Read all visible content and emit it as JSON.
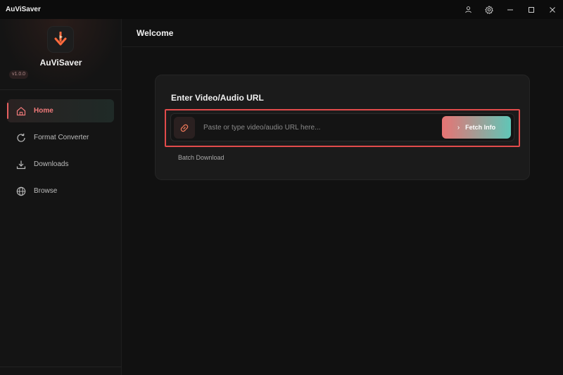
{
  "window": {
    "title": "AuViSaver"
  },
  "titlebar_icons": [
    "user-icon",
    "gear-icon",
    "minimize-icon",
    "maximize-icon",
    "close-icon"
  ],
  "sidebar": {
    "app_name": "AuViSaver",
    "version": "v1.0.0",
    "items": [
      {
        "label": "Home",
        "icon": "home-icon",
        "active": true
      },
      {
        "label": "Format Converter",
        "icon": "refresh-icon",
        "active": false
      },
      {
        "label": "Downloads",
        "icon": "download-icon",
        "active": false
      },
      {
        "label": "Browse",
        "icon": "globe-icon",
        "active": false
      }
    ]
  },
  "header": {
    "title": "Welcome"
  },
  "card": {
    "title": "Enter Video/Audio URL",
    "url_input": {
      "value": "",
      "placeholder": "Paste or type video/audio URL here..."
    },
    "fetch_button": "Fetch Info",
    "batch_link": "Batch Download"
  },
  "colors": {
    "accent": "#e86060",
    "highlight_border": "#e24b4b",
    "gradient_start": "#e87373",
    "gradient_end": "#5fc6b7",
    "background": "#111111"
  }
}
